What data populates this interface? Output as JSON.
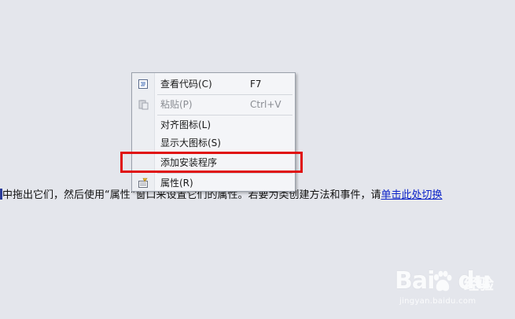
{
  "body_text": {
    "prefix": "中拖出它们，然后使用“属性”窗口来设置它们的属性。若要为类创建方法和事件，请",
    "link": "单击此处切换"
  },
  "context_menu": {
    "items": [
      {
        "label": "查看代码(C)",
        "shortcut": "F7",
        "icon": "view-code-icon",
        "enabled": true
      },
      {
        "label": "粘贴(P)",
        "shortcut": "Ctrl+V",
        "icon": "paste-icon",
        "enabled": false
      },
      {
        "label": "对齐图标(L)",
        "shortcut": "",
        "icon": "",
        "enabled": true
      },
      {
        "label": "显示大图标(S)",
        "shortcut": "",
        "icon": "",
        "enabled": true
      },
      {
        "label": "添加安装程序",
        "shortcut": "",
        "icon": "",
        "enabled": true,
        "highlighted": true
      },
      {
        "label": "属性(R)",
        "shortcut": "",
        "icon": "properties-icon",
        "enabled": true
      }
    ]
  },
  "annotation": {
    "highlight_color": "#e01010"
  },
  "watermark": {
    "brand": "Bai",
    "brand_suffix": "du",
    "cn_text": "经验",
    "url": "jingyan.baidu.com"
  }
}
